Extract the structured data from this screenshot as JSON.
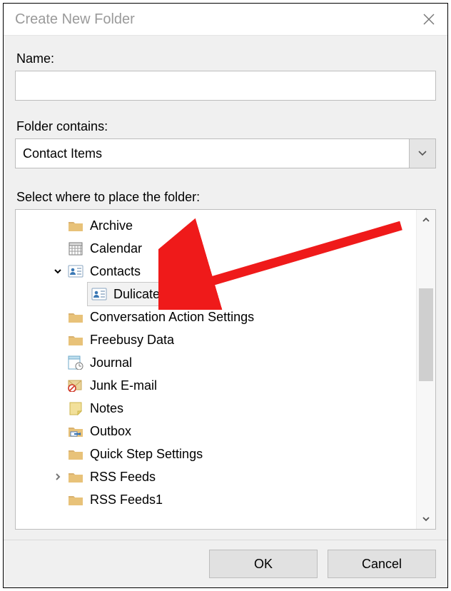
{
  "dialog": {
    "title": "Create New Folder"
  },
  "labels": {
    "name": "Name:",
    "folder_contains": "Folder contains:",
    "select_where": "Select where to place the folder:"
  },
  "fields": {
    "name_value": "",
    "folder_contains_value": "Contact Items"
  },
  "tree": {
    "items": [
      {
        "indent": 1,
        "expander": "",
        "icon": "folder",
        "label": "Archive",
        "selected": false
      },
      {
        "indent": 1,
        "expander": "",
        "icon": "calendar",
        "label": "Calendar",
        "selected": false
      },
      {
        "indent": 1,
        "expander": "open",
        "icon": "contacts",
        "label": "Contacts",
        "selected": false
      },
      {
        "indent": 2,
        "expander": "",
        "icon": "contacts",
        "label": "Dulicates",
        "selected": true
      },
      {
        "indent": 1,
        "expander": "",
        "icon": "folder",
        "label": "Conversation Action Settings",
        "selected": false
      },
      {
        "indent": 1,
        "expander": "",
        "icon": "folder",
        "label": "Freebusy Data",
        "selected": false
      },
      {
        "indent": 1,
        "expander": "",
        "icon": "journal",
        "label": "Journal",
        "selected": false
      },
      {
        "indent": 1,
        "expander": "",
        "icon": "junk",
        "label": "Junk E-mail",
        "selected": false
      },
      {
        "indent": 1,
        "expander": "",
        "icon": "notes",
        "label": "Notes",
        "selected": false
      },
      {
        "indent": 1,
        "expander": "",
        "icon": "outbox",
        "label": "Outbox",
        "selected": false
      },
      {
        "indent": 1,
        "expander": "",
        "icon": "folder",
        "label": "Quick Step Settings",
        "selected": false
      },
      {
        "indent": 1,
        "expander": "closed",
        "icon": "folder",
        "label": "RSS Feeds",
        "selected": false
      },
      {
        "indent": 1,
        "expander": "",
        "icon": "folder",
        "label": "RSS Feeds1",
        "selected": false
      }
    ]
  },
  "buttons": {
    "ok": "OK",
    "cancel": "Cancel"
  },
  "icons": {
    "folder_fill": "#e8c279",
    "folder_tab": "#d9b170"
  }
}
